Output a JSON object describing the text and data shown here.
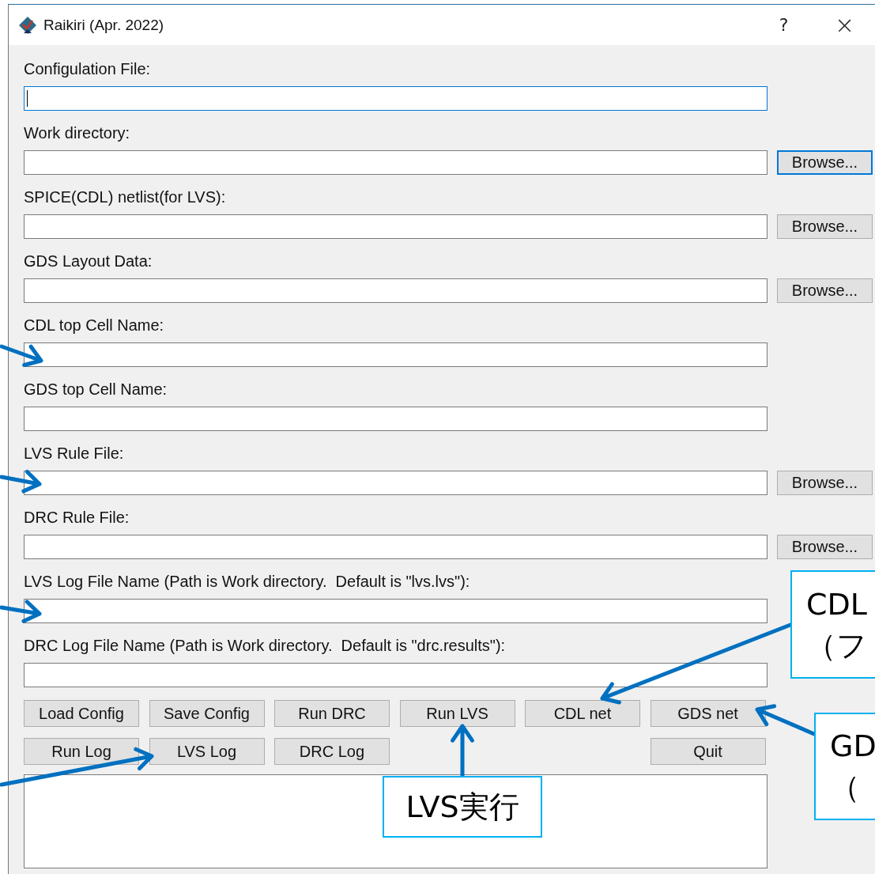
{
  "window": {
    "title": "Raikiri (Apr. 2022)",
    "help": "?",
    "close": "×"
  },
  "fields": [
    {
      "label": "Configulation File:",
      "focused": true
    },
    {
      "label": "Work directory:",
      "focused": false,
      "browse": {
        "label": "Browse...",
        "focused": true
      }
    },
    {
      "label": "SPICE(CDL) netlist(for LVS):",
      "focused": false,
      "browse": {
        "label": "Browse...",
        "focused": false
      }
    },
    {
      "label": "GDS Layout Data:",
      "focused": false,
      "browse": {
        "label": "Browse...",
        "focused": false
      }
    },
    {
      "label": "CDL top Cell Name:",
      "focused": false
    },
    {
      "label": "GDS top Cell Name:",
      "focused": false
    },
    {
      "label": "LVS Rule File:",
      "focused": false,
      "browse": {
        "label": "Browse...",
        "focused": false
      }
    },
    {
      "label": "DRC Rule File:",
      "focused": false,
      "browse": {
        "label": "Browse...",
        "focused": false
      }
    },
    {
      "label": "LVS Log File Name (Path is Work directory.  Default is \"lvs.lvs\"):",
      "focused": false
    },
    {
      "label": "DRC Log File Name (Path is Work directory.  Default is \"drc.results\"):",
      "focused": false
    }
  ],
  "button_rows": [
    [
      "Load Config",
      "Save Config",
      "Run DRC",
      "Run LVS",
      "CDL net",
      "GDS net"
    ],
    [
      "Run Log",
      "LVS Log",
      "DRC Log",
      "Quit"
    ]
  ],
  "callouts": [
    {
      "lines": [
        "CDL",
        "（フ"
      ]
    },
    {
      "lines": [
        "GD",
        "（"
      ]
    },
    {
      "lines": [
        "LVS実行"
      ]
    }
  ]
}
